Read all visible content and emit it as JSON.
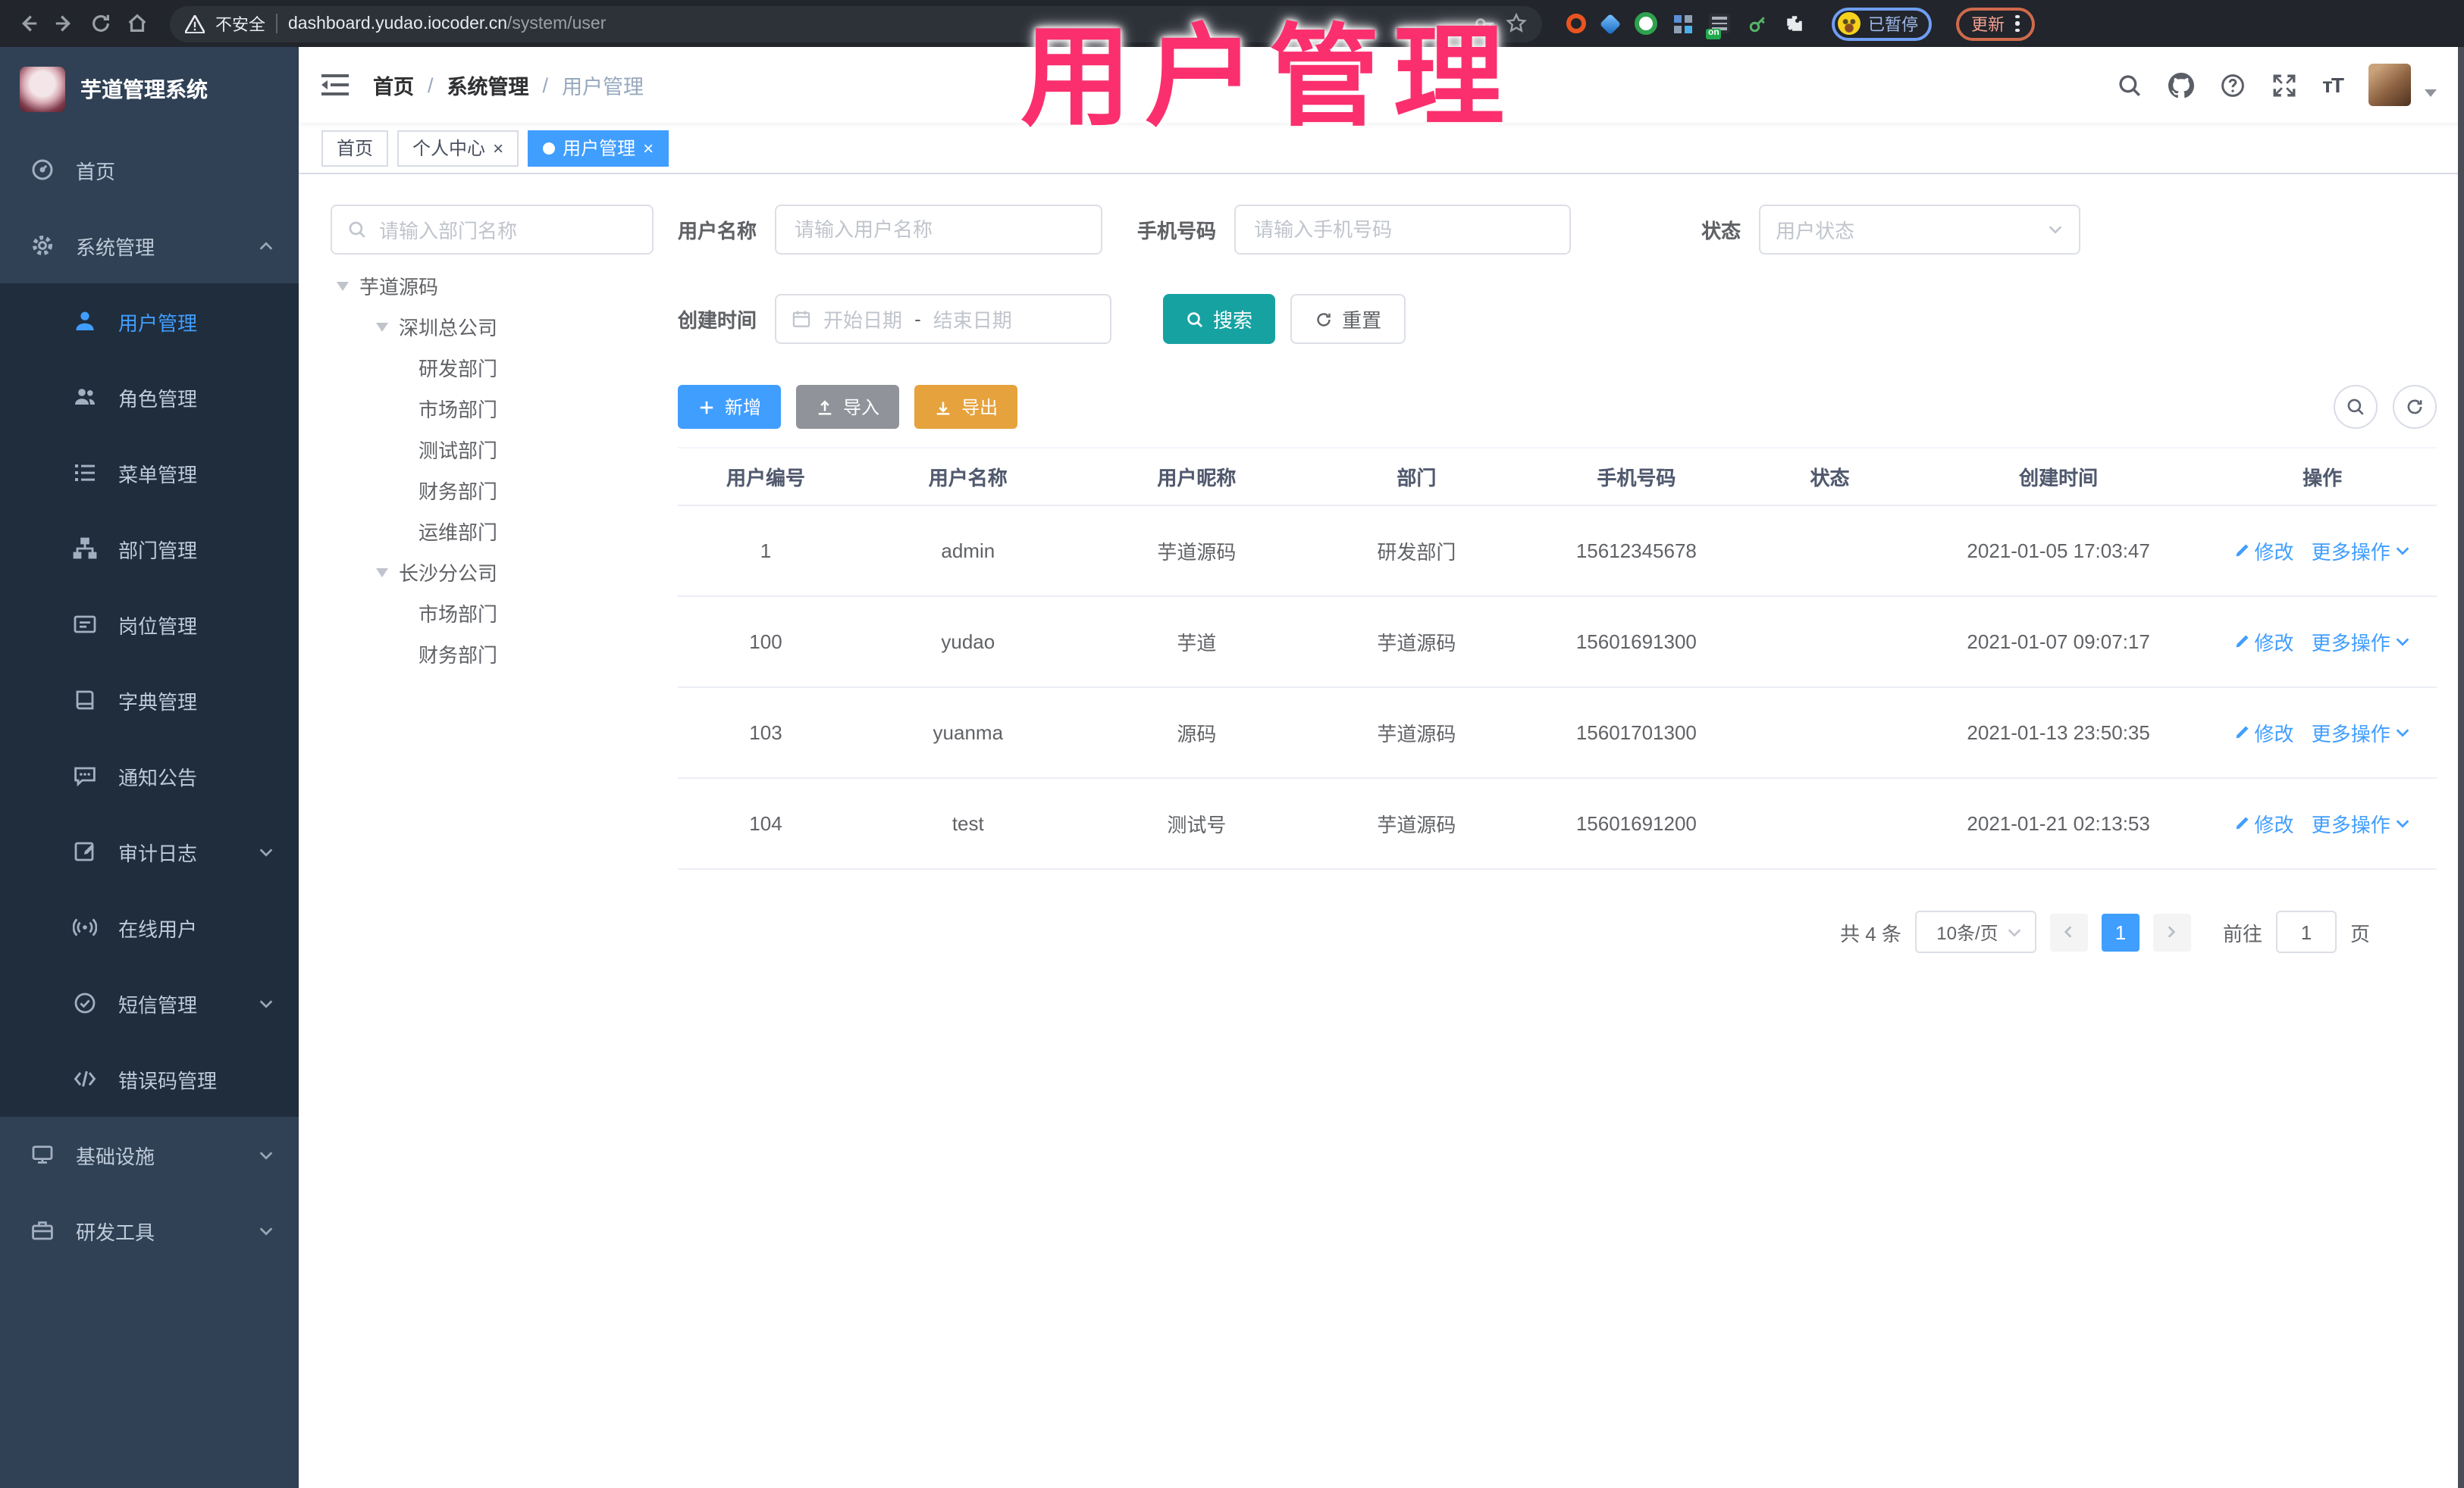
{
  "browser": {
    "security_warning": "不安全",
    "url_host": "dashboard.yudao.iocoder.cn",
    "url_path": "/system/user",
    "profile_status": "已暂停",
    "update_label": "更新"
  },
  "overlay_title": "用户管理",
  "sidebar": {
    "app_title": "芋道管理系统",
    "items": [
      {
        "label": "首页"
      },
      {
        "label": "系统管理"
      },
      {
        "label": "用户管理"
      },
      {
        "label": "角色管理"
      },
      {
        "label": "菜单管理"
      },
      {
        "label": "部门管理"
      },
      {
        "label": "岗位管理"
      },
      {
        "label": "字典管理"
      },
      {
        "label": "通知公告"
      },
      {
        "label": "审计日志"
      },
      {
        "label": "在线用户"
      },
      {
        "label": "短信管理"
      },
      {
        "label": "错误码管理"
      },
      {
        "label": "基础设施"
      },
      {
        "label": "研发工具"
      }
    ]
  },
  "header": {
    "breadcrumb": [
      "首页",
      "系统管理",
      "用户管理"
    ],
    "separator": "/"
  },
  "tabs": [
    {
      "label": "首页"
    },
    {
      "label": "个人中心",
      "close": "×"
    },
    {
      "label": "用户管理",
      "close": "×"
    }
  ],
  "dept_panel": {
    "search_placeholder": "请输入部门名称",
    "tree": [
      {
        "label": "芋道源码"
      },
      {
        "label": "深圳总公司"
      },
      {
        "label": "研发部门"
      },
      {
        "label": "市场部门"
      },
      {
        "label": "测试部门"
      },
      {
        "label": "财务部门"
      },
      {
        "label": "运维部门"
      },
      {
        "label": "长沙分公司"
      },
      {
        "label": "市场部门"
      },
      {
        "label": "财务部门"
      }
    ]
  },
  "filters": {
    "username_label": "用户名称",
    "username_placeholder": "请输入用户名称",
    "mobile_label": "手机号码",
    "mobile_placeholder": "请输入手机号码",
    "status_label": "状态",
    "status_placeholder": "用户状态",
    "create_time_label": "创建时间",
    "date_start_placeholder": "开始日期",
    "date_separator": "-",
    "date_end_placeholder": "结束日期",
    "search_label": "搜索",
    "reset_label": "重置"
  },
  "toolbar": {
    "add_label": "新增",
    "import_label": "导入",
    "export_label": "导出"
  },
  "table": {
    "columns": [
      "用户编号",
      "用户名称",
      "用户昵称",
      "部门",
      "手机号码",
      "状态",
      "创建时间",
      "操作"
    ],
    "action_labels": {
      "edit": "修改",
      "more": "更多操作"
    },
    "rows": [
      {
        "id": "1",
        "username": "admin",
        "nickname": "芋道源码",
        "dept": "研发部门",
        "mobile": "15612345678",
        "status_on": true,
        "created": "2021-01-05 17:03:47"
      },
      {
        "id": "100",
        "username": "yudao",
        "nickname": "芋道",
        "dept": "芋道源码",
        "mobile": "15601691300",
        "status_on": false,
        "created": "2021-01-07 09:07:17"
      },
      {
        "id": "103",
        "username": "yuanma",
        "nickname": "源码",
        "dept": "芋道源码",
        "mobile": "15601701300",
        "status_on": true,
        "created": "2021-01-13 23:50:35"
      },
      {
        "id": "104",
        "username": "test",
        "nickname": "测试号",
        "dept": "芋道源码",
        "mobile": "15601691200",
        "status_on": true,
        "created": "2021-01-21 02:13:53"
      }
    ]
  },
  "pagination": {
    "total_text": "共 4 条",
    "page_size": "10条/页",
    "current_page": "1",
    "goto_label": "前往",
    "goto_value": "1",
    "page_unit": "页"
  },
  "colors": {
    "primary_blue": "#409eff",
    "search_teal": "#17a2a2",
    "export_orange": "#e6a23c",
    "import_gray": "#909399",
    "overlay_pink": "#fb2f6e",
    "sidebar_bg": "#304156",
    "submenu_bg": "#1f2d3d",
    "toggle_on": "#2d8cf0"
  }
}
